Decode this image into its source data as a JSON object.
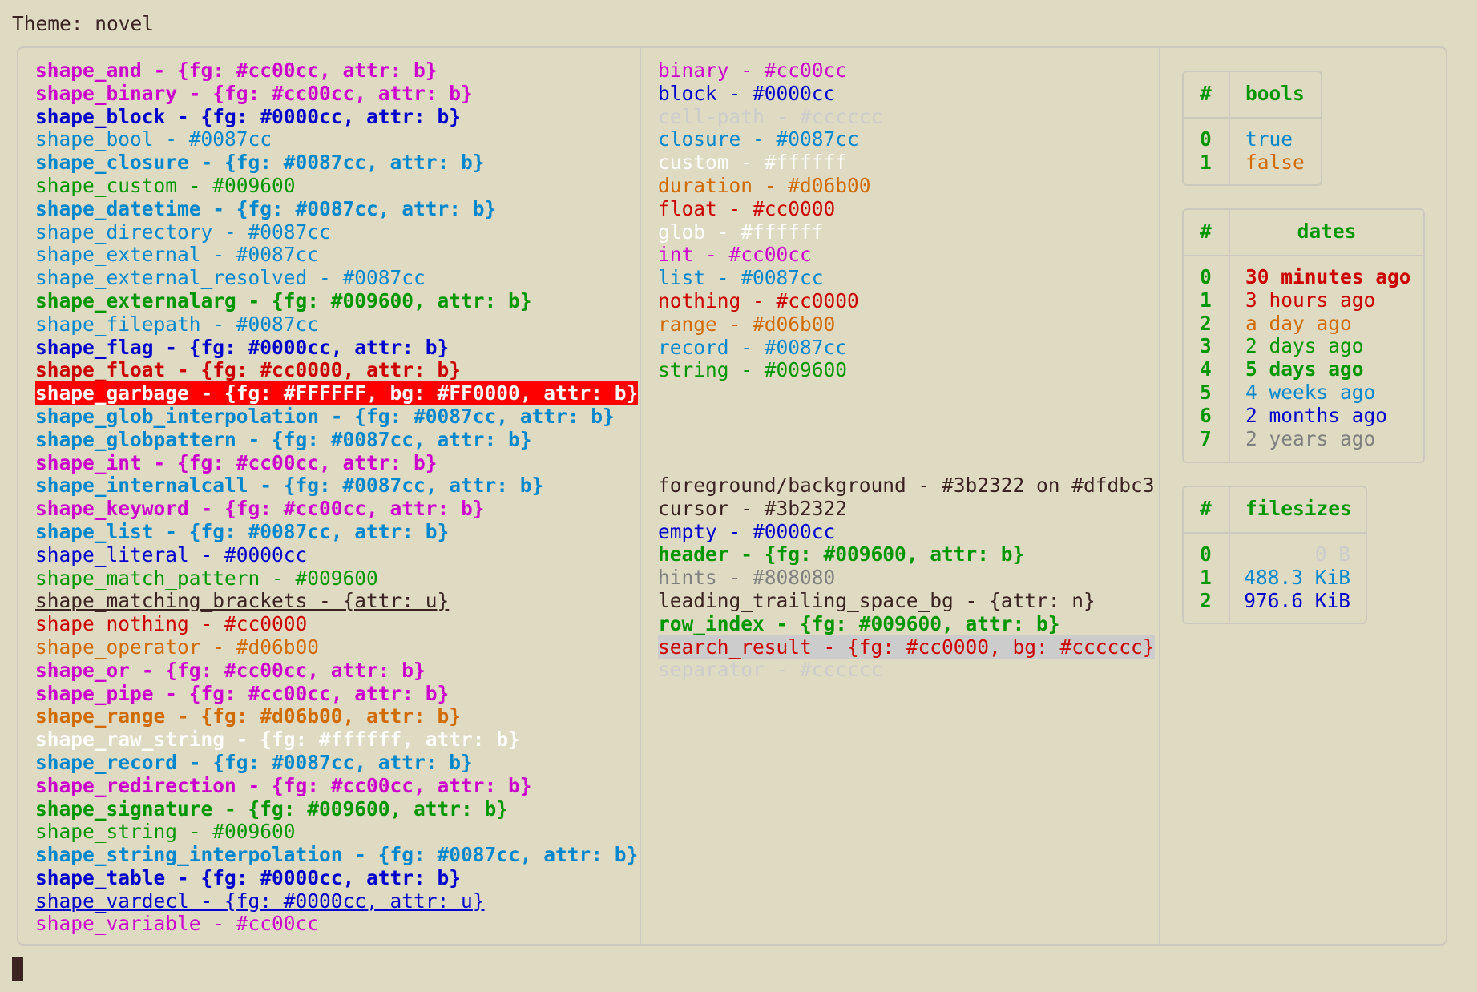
{
  "title": "Theme: novel",
  "left_entries": [
    {
      "text": "shape_and - {fg: #cc00cc, attr: b}",
      "fg": "#cc00cc",
      "bold": true
    },
    {
      "text": "shape_binary - {fg: #cc00cc, attr: b}",
      "fg": "#cc00cc",
      "bold": true
    },
    {
      "text": "shape_block - {fg: #0000cc, attr: b}",
      "fg": "#0000cc",
      "bold": true
    },
    {
      "text": "shape_bool - #0087cc",
      "fg": "#0087cc"
    },
    {
      "text": "shape_closure - {fg: #0087cc, attr: b}",
      "fg": "#0087cc",
      "bold": true
    },
    {
      "text": "shape_custom - #009600",
      "fg": "#009600"
    },
    {
      "text": "shape_datetime - {fg: #0087cc, attr: b}",
      "fg": "#0087cc",
      "bold": true
    },
    {
      "text": "shape_directory - #0087cc",
      "fg": "#0087cc"
    },
    {
      "text": "shape_external - #0087cc",
      "fg": "#0087cc"
    },
    {
      "text": "shape_external_resolved - #0087cc",
      "fg": "#0087cc"
    },
    {
      "text": "shape_externalarg - {fg: #009600, attr: b}",
      "fg": "#009600",
      "bold": true
    },
    {
      "text": "shape_filepath - #0087cc",
      "fg": "#0087cc"
    },
    {
      "text": "shape_flag - {fg: #0000cc, attr: b}",
      "fg": "#0000cc",
      "bold": true
    },
    {
      "text": "shape_float - {fg: #cc0000, attr: b}",
      "fg": "#cc0000",
      "bold": true
    },
    {
      "text": "shape_garbage - {fg: #FFFFFF, bg: #FF0000, attr: b}",
      "fg": "#FFFFFF",
      "bg": "#FF0000",
      "bold": true
    },
    {
      "text": "shape_glob_interpolation - {fg: #0087cc, attr: b}",
      "fg": "#0087cc",
      "bold": true
    },
    {
      "text": "shape_globpattern - {fg: #0087cc, attr: b}",
      "fg": "#0087cc",
      "bold": true
    },
    {
      "text": "shape_int - {fg: #cc00cc, attr: b}",
      "fg": "#cc00cc",
      "bold": true
    },
    {
      "text": "shape_internalcall - {fg: #0087cc, attr: b}",
      "fg": "#0087cc",
      "bold": true
    },
    {
      "text": "shape_keyword - {fg: #cc00cc, attr: b}",
      "fg": "#cc00cc",
      "bold": true
    },
    {
      "text": "shape_list - {fg: #0087cc, attr: b}",
      "fg": "#0087cc",
      "bold": true
    },
    {
      "text": "shape_literal - #0000cc",
      "fg": "#0000cc"
    },
    {
      "text": "shape_match_pattern - #009600",
      "fg": "#009600"
    },
    {
      "text": "shape_matching_brackets - {attr: u}",
      "fg": "#3b2322",
      "underline": true
    },
    {
      "text": "shape_nothing - #cc0000",
      "fg": "#cc0000"
    },
    {
      "text": "shape_operator - #d06b00",
      "fg": "#d06b00"
    },
    {
      "text": "shape_or - {fg: #cc00cc, attr: b}",
      "fg": "#cc00cc",
      "bold": true
    },
    {
      "text": "shape_pipe - {fg: #cc00cc, attr: b}",
      "fg": "#cc00cc",
      "bold": true
    },
    {
      "text": "shape_range - {fg: #d06b00, attr: b}",
      "fg": "#d06b00",
      "bold": true
    },
    {
      "text": "shape_raw_string - {fg: #ffffff, attr: b}",
      "fg": "#ffffff",
      "bold": true
    },
    {
      "text": "shape_record - {fg: #0087cc, attr: b}",
      "fg": "#0087cc",
      "bold": true
    },
    {
      "text": "shape_redirection - {fg: #cc00cc, attr: b}",
      "fg": "#cc00cc",
      "bold": true
    },
    {
      "text": "shape_signature - {fg: #009600, attr: b}",
      "fg": "#009600",
      "bold": true
    },
    {
      "text": "shape_string - #009600",
      "fg": "#009600"
    },
    {
      "text": "shape_string_interpolation - {fg: #0087cc, attr: b}",
      "fg": "#0087cc",
      "bold": true
    },
    {
      "text": "shape_table - {fg: #0000cc, attr: b}",
      "fg": "#0000cc",
      "bold": true
    },
    {
      "text": "shape_vardecl - {fg: #0000cc, attr: u}",
      "fg": "#0000cc",
      "underline": true
    },
    {
      "text": "shape_variable - #cc00cc",
      "fg": "#cc00cc"
    }
  ],
  "middle_types": [
    {
      "text": "binary - #cc00cc",
      "fg": "#cc00cc"
    },
    {
      "text": "block - #0000cc",
      "fg": "#0000cc"
    },
    {
      "text": "cell-path - #cccccc",
      "fg": "#cccccc"
    },
    {
      "text": "closure - #0087cc",
      "fg": "#0087cc"
    },
    {
      "text": "custom - #ffffff",
      "fg": "#ffffff"
    },
    {
      "text": "duration - #d06b00",
      "fg": "#d06b00"
    },
    {
      "text": "float - #cc0000",
      "fg": "#cc0000"
    },
    {
      "text": "glob - #ffffff",
      "fg": "#ffffff"
    },
    {
      "text": "int - #cc00cc",
      "fg": "#cc00cc"
    },
    {
      "text": "list - #0087cc",
      "fg": "#0087cc"
    },
    {
      "text": "nothing - #cc0000",
      "fg": "#cc0000"
    },
    {
      "text": "range - #d06b00",
      "fg": "#d06b00"
    },
    {
      "text": "record - #0087cc",
      "fg": "#0087cc"
    },
    {
      "text": "string - #009600",
      "fg": "#009600"
    }
  ],
  "middle_ui": [
    {
      "text": "foreground/background - #3b2322 on #dfdbc3",
      "fg": "#3b2322"
    },
    {
      "text": "cursor - #3b2322",
      "fg": "#3b2322"
    },
    {
      "text": "empty - #0000cc",
      "fg": "#0000cc"
    },
    {
      "text": "header - {fg: #009600, attr: b}",
      "fg": "#009600",
      "bold": true
    },
    {
      "text": "hints - #808080",
      "fg": "#808080"
    },
    {
      "text": "leading_trailing_space_bg - {attr: n}",
      "fg": "#3b2322"
    },
    {
      "text": "row_index - {fg: #009600, attr: b}",
      "fg": "#009600",
      "bold": true
    },
    {
      "text": "search_result - {fg: #cc0000, bg: #cccccc}",
      "fg": "#cc0000",
      "bg": "#cccccc"
    },
    {
      "text": "separator - #cccccc",
      "fg": "#cccccc"
    }
  ],
  "bools": {
    "header_index": "#",
    "header": "bools",
    "rows": [
      {
        "index": "0",
        "value": "true",
        "fg": "#0087cc"
      },
      {
        "index": "1",
        "value": "false",
        "fg": "#d06b00"
      }
    ]
  },
  "dates": {
    "header_index": "#",
    "header": "dates",
    "rows": [
      {
        "index": "0",
        "value": "30 minutes ago",
        "fg": "#cc0000",
        "bold": true
      },
      {
        "index": "1",
        "value": "3 hours ago",
        "fg": "#cc0000"
      },
      {
        "index": "2",
        "value": "a day ago",
        "fg": "#d06b00"
      },
      {
        "index": "3",
        "value": "2 days ago",
        "fg": "#009600"
      },
      {
        "index": "4",
        "value": "5 days ago",
        "fg": "#009600",
        "bold": true
      },
      {
        "index": "5",
        "value": "4 weeks ago",
        "fg": "#0087cc"
      },
      {
        "index": "6",
        "value": "2 months ago",
        "fg": "#0000cc"
      },
      {
        "index": "7",
        "value": "2 years ago",
        "fg": "#808080"
      }
    ]
  },
  "filesizes": {
    "header_index": "#",
    "header": "filesizes",
    "rows": [
      {
        "index": "0",
        "value": "0 B",
        "fg": "#cccccc"
      },
      {
        "index": "1",
        "value": "488.3 KiB",
        "fg": "#0087cc"
      },
      {
        "index": "2",
        "value": "976.6 KiB",
        "fg": "#0000cc"
      }
    ]
  },
  "colors": {
    "background": "#dfdbc3",
    "foreground": "#3b2322",
    "header": "#009600",
    "border": "#cbc9bd"
  }
}
